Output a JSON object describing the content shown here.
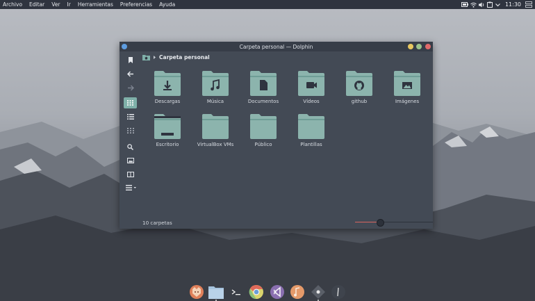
{
  "menubar": {
    "items": [
      "Archivo",
      "Editar",
      "Ver",
      "Ir",
      "Herramientas",
      "Preferencias",
      "Ayuda"
    ],
    "clock": "11:30",
    "tray_icons": [
      "battery-icon",
      "wifi-icon",
      "volume-icon",
      "clipboard-icon",
      "chevron-down-icon",
      "notifications-icon"
    ]
  },
  "window": {
    "title": "Carpeta personal — Dolphin",
    "breadcrumb": {
      "label": "Carpeta personal",
      "icon": "home-folder-icon"
    },
    "sidebar": [
      "bookmark-icon",
      "back-arrow-icon",
      "forward-arrow-icon",
      "icons-view-icon",
      "details-view-icon",
      "compact-view-icon",
      "search-icon",
      "preview-icon",
      "split-view-icon",
      "menu-icon"
    ],
    "folders": [
      {
        "label": "Descargas",
        "icon": "download-icon"
      },
      {
        "label": "Música",
        "icon": "music-icon"
      },
      {
        "label": "Documentos",
        "icon": "document-icon"
      },
      {
        "label": "Vídeos",
        "icon": "video-icon"
      },
      {
        "label": "github",
        "icon": "github-icon"
      },
      {
        "label": "Imágenes",
        "icon": "image-icon"
      },
      {
        "label": "Escritorio",
        "icon": "desktop-icon"
      },
      {
        "label": "VirtualBox VMs",
        "icon": "plain-folder-icon"
      },
      {
        "label": "Público",
        "icon": "plain-folder-icon"
      },
      {
        "label": "Plantillas",
        "icon": "plain-folder-icon"
      }
    ],
    "status": "10 carpetas",
    "zoom_level": 0.32
  },
  "dock": [
    "firefox",
    "files",
    "terminal",
    "chrome",
    "vscode",
    "music-player",
    "settings",
    "stopwatch"
  ],
  "colors": {
    "menubar": "#2f343f",
    "window_bg": "#434a55",
    "titlebar": "#373d48",
    "accent": "#7fb0a9",
    "folder": "#8cb4ad",
    "close": "#e06a6a",
    "minimize": "#e8c760",
    "maximize": "#9cc28c"
  }
}
